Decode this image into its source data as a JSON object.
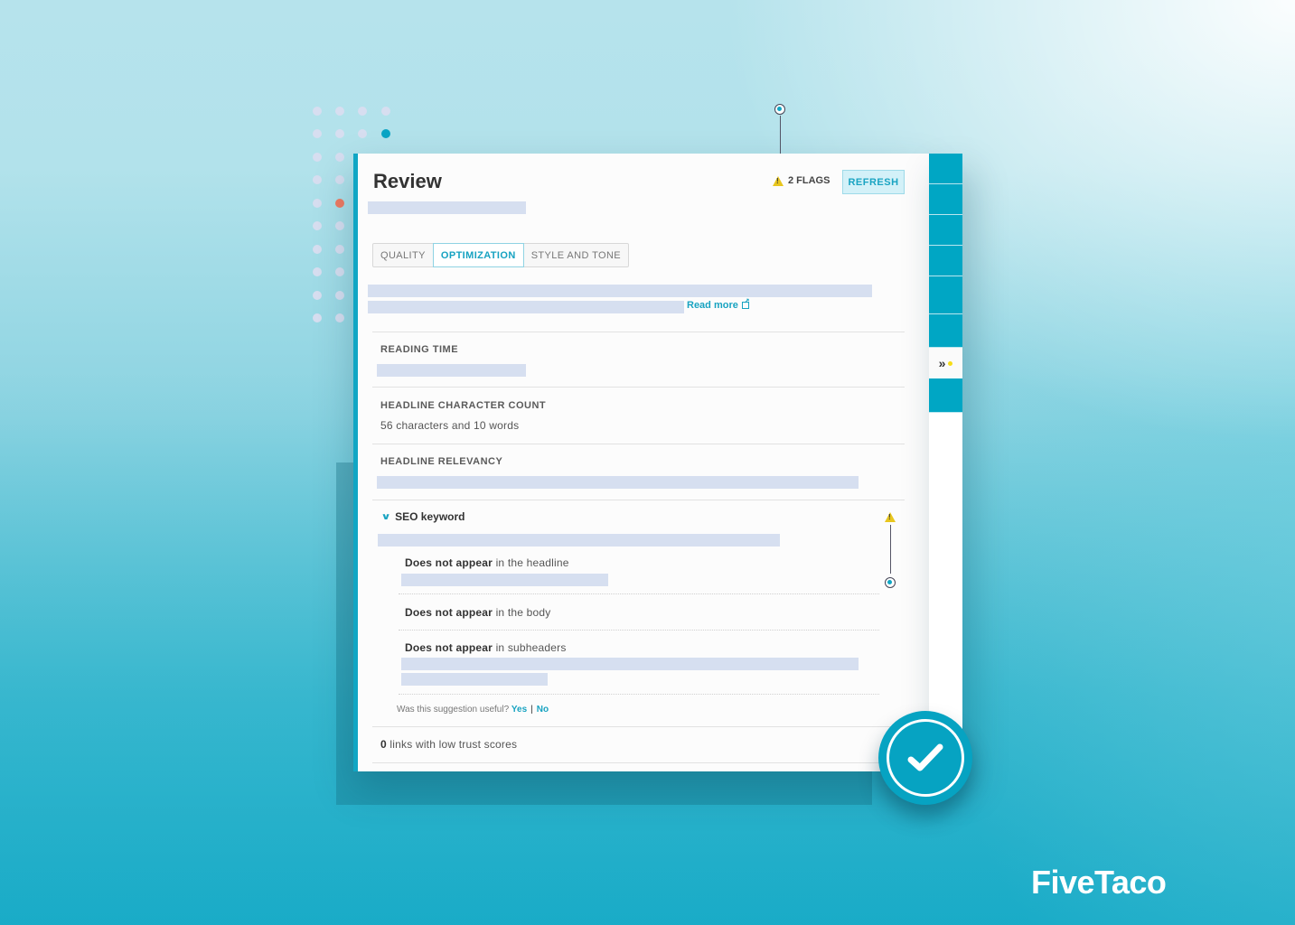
{
  "panel": {
    "title": "Review",
    "flags": {
      "count_label": "2 FLAGS",
      "icon": "warning-icon"
    },
    "refresh_label": "REFRESH",
    "tabs": [
      {
        "label": "QUALITY",
        "active": false
      },
      {
        "label": "OPTIMIZATION",
        "active": true
      },
      {
        "label": "STYLE AND TONE",
        "active": false
      }
    ],
    "read_more_label": "Read more",
    "sections": {
      "reading_time": {
        "label": "READING TIME"
      },
      "headline_count": {
        "label": "HEADLINE CHARACTER COUNT",
        "value": "56 characters and 10 words"
      },
      "headline_relevancy": {
        "label": "HEADLINE RELEVANCY"
      },
      "seo_keyword": {
        "label": "SEO keyword",
        "items": [
          {
            "bold": "Does not appear",
            "rest": " in the headline"
          },
          {
            "bold": "Does not appear",
            "rest": " in the body"
          },
          {
            "bold": "Does not appear",
            "rest": " in subheaders"
          }
        ],
        "feedback": {
          "question": "Was this suggestion useful?",
          "yes": "Yes",
          "separator": "|",
          "no": "No"
        }
      },
      "links": {
        "count": "0",
        "rest": " links with low trust scores"
      }
    }
  },
  "side_rail": {
    "toggle_icon": "double-chevron-right-icon"
  },
  "brand": {
    "name": "FiveTaco"
  },
  "colors": {
    "accent": "#00a6c4",
    "warning": "#e8c61e",
    "placeholder": "#d6dff0",
    "coral": "#f07a62"
  }
}
